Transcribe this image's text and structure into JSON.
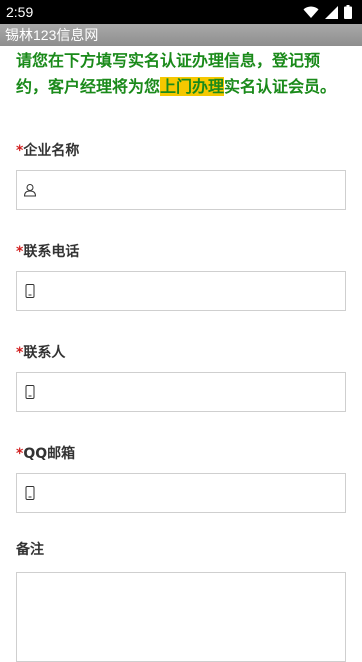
{
  "status_bar": {
    "time": "2:59"
  },
  "title_bar": {
    "title": "锡林123信息网"
  },
  "intro": {
    "text_before": "请您在下方填写实名认证办理信息，登记预约，客户经理将为您",
    "highlight": "上门办理",
    "text_after": "实名认证会员。"
  },
  "form": {
    "fields": [
      {
        "required_mark": "*",
        "label": "企业名称",
        "icon": "person-icon"
      },
      {
        "required_mark": "*",
        "label": "联系电话",
        "icon": "phone-icon"
      },
      {
        "required_mark": "*",
        "label": "联系人",
        "icon": "phone-icon"
      },
      {
        "required_mark": "*",
        "label": "QQ邮箱",
        "icon": "phone-icon"
      }
    ],
    "remark_label": "备注"
  },
  "colors": {
    "intro_text": "#1a8a1a",
    "highlight": "#f5c800",
    "required": "#d11f1f"
  }
}
